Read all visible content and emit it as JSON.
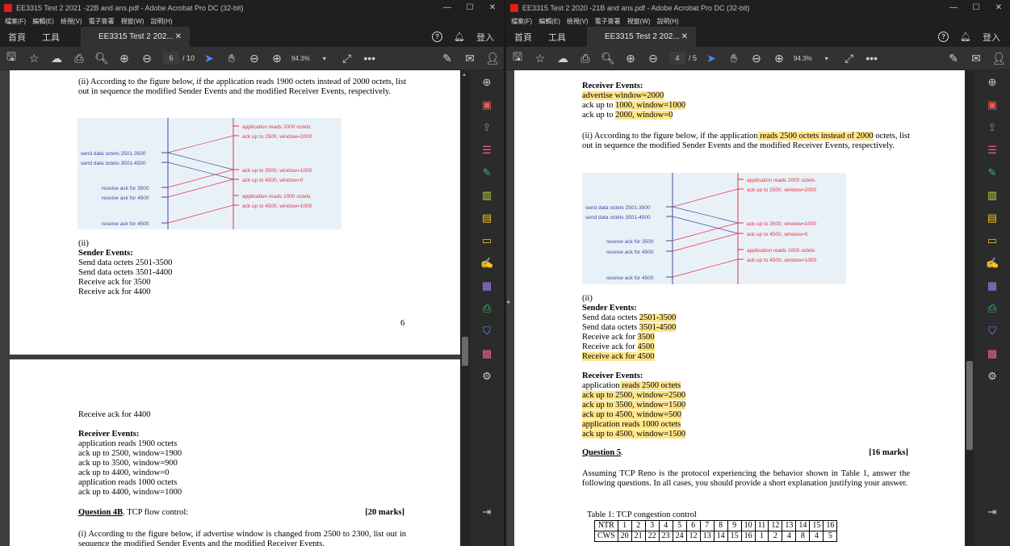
{
  "left_window": {
    "title": "EE3315 Test 2 2021 -22B and ans.pdf - Adobe Acrobat Pro DC (32-bit)",
    "menu": [
      "檔案(F)",
      "編輯(E)",
      "檢視(V)",
      "電子簽署",
      "視窗(W)",
      "說明(H)"
    ],
    "tabs": {
      "home": "首頁",
      "tools": "工具",
      "doc": "EE3315 Test 2 202...",
      "login": "登入"
    },
    "page_current": "6",
    "page_total": "/ 10",
    "zoom": "94.3%",
    "page6": {
      "q": "(ii) According to the figure below, if the application reads 1900 octets instead of 2000 octets, list out in sequence the modified Sender Events and the modified Receiver Events, respectively.",
      "ans_num": "(ii)",
      "sender_title": "Sender Events:",
      "sender_lines": [
        "Send data octets 2501-3500",
        "Send data octets 3501-4400",
        "Receive ack for 3500",
        "Receive ack for 4400"
      ],
      "page_number": "6"
    },
    "page7": {
      "line1": "Receive ack for 4400",
      "receiver_title": "Receiver Events:",
      "receiver_lines": [
        "application reads 1900 octets",
        "ack up to 2500, window=1900",
        "ack up to 3500, window=900",
        "ack up to 4400, window=0",
        "application reads 1000 octets",
        "ack up to 4400, window=1000"
      ],
      "q4b_title": "Question 4B",
      "q4b_sub": ". TCP flow control:",
      "q4b_marks": "[20 marks]",
      "q4b_text": "(i) According to the figure below, if advertise window is changed from 2500 to 2300, list out in sequence the modified Sender Events and the modified Receiver Events,"
    }
  },
  "right_window": {
    "title": "EE3315 Test 2 2020 -21B and ans.pdf - Adobe Acrobat Pro DC (32-bit)",
    "menu": [
      "檔案(F)",
      "編輯(E)",
      "檢視(V)",
      "電子簽署",
      "視窗(W)",
      "說明(H)"
    ],
    "tabs": {
      "home": "首頁",
      "tools": "工具",
      "doc": "EE3315 Test 2 202...",
      "login": "登入"
    },
    "page_current": "4",
    "page_total": "/ 5",
    "zoom": "94.3%",
    "page4": {
      "recv_top_title": "Receiver Events:",
      "recv_top_1": "advertise window=2000",
      "recv_top_2a": "ack up to ",
      "recv_top_2b": "1000, window=1000",
      "recv_top_3a": "ack up to ",
      "recv_top_3b": "2000, window=0",
      "q_a": "(ii) According to the figure below, if the application",
      "q_b": " reads 2500 octets instead of 2000",
      "q_c": " octets, list out in sequence the modified Sender Events and the modified Receiver Events, respectively.",
      "ans_num": "(ii)",
      "sender_title": "Sender Events:",
      "s1a": "Send data octets ",
      "s1b": "2501-3500",
      "s2a": "Send data octets ",
      "s2b": "3501-4500",
      "s3a": "Receive ack for ",
      "s3b": "3500",
      "s4a": "Receive ack for ",
      "s4b": "4500",
      "s5": "Receive ack for 4500",
      "receiver_title": "Receiver Events:",
      "r1a": "application",
      "r1b": " reads 2500 octets",
      "r_lines": [
        "ack up to 2500, window=2500",
        "ack up to 3500, window=1500",
        "ack up to 4500, window=500",
        "application reads 1000 octets",
        "ack up to 4500, window=1500"
      ],
      "q5_title": "Question 5",
      "q5_dot": ".",
      "q5_marks": "[16 marks]",
      "q5_text": "Assuming TCP Reno is the protocol experiencing the behavior shown in Table 1, answer the following questions. In all cases, you should provide a short explanation justifying your answer.",
      "table_caption": "Table 1: TCP congestion control",
      "table": {
        "NTR": [
          "NTR",
          "1",
          "2",
          "3",
          "4",
          "5",
          "6",
          "7",
          "8",
          "9",
          "10",
          "11",
          "12",
          "13",
          "14",
          "15",
          "16"
        ],
        "CWS": [
          "CWS",
          "20",
          "21",
          "22",
          "23",
          "24",
          "12",
          "13",
          "14",
          "15",
          "16",
          "1",
          "2",
          "4",
          "8",
          "4",
          "5"
        ]
      }
    }
  },
  "figure": {
    "left_labels": [
      "send data octets 2501-3500",
      "send data octets 3501-4500",
      "receive ack for 3500",
      "receive ack for 4500",
      "receive ack for 4500"
    ],
    "right_labels": [
      "application reads 2000 octets",
      "ack up to 2500, window=2000",
      "ack up to 3500, window=1000",
      "ack up to 4500, window=0",
      "application reads 1000 octets",
      "ack up to 4500, window=1000"
    ],
    "colors": {
      "sender": "#3b4aa0",
      "receiver": "#e5333f",
      "background": "#e9f1f8"
    }
  },
  "colors": {
    "highlight": "#ffe58a",
    "acrobat_red": "#e0201b",
    "toolbar_blue": "#3f8df3"
  }
}
